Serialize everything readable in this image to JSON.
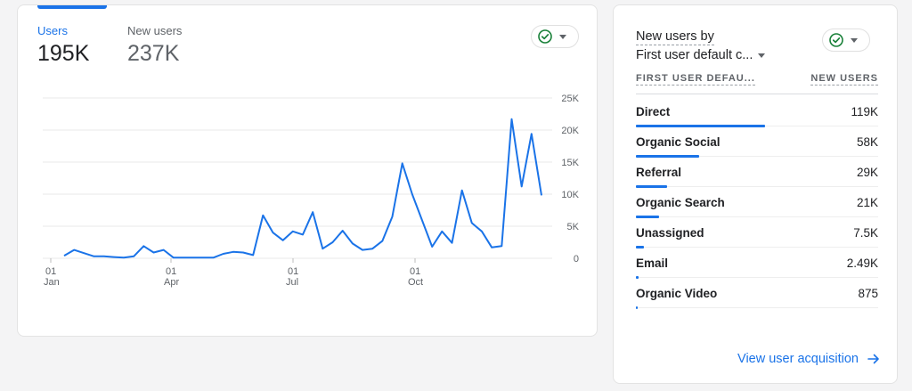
{
  "metrics": {
    "users": {
      "label": "Users",
      "value": "195K"
    },
    "new_users": {
      "label": "New users",
      "value": "237K"
    }
  },
  "colors": {
    "accent": "#1a73e8",
    "check": "#188038",
    "text": "#202124",
    "muted": "#5f6368"
  },
  "icons": {
    "compare": "check-circle-icon",
    "dropdown": "caret-down-icon",
    "link": "arrow-right-icon"
  },
  "chart_data": {
    "type": "line",
    "ylim": [
      0,
      25000
    ],
    "y_ticks": [
      "25K",
      "20K",
      "15K",
      "10K",
      "5K",
      "0"
    ],
    "x_ticks": [
      {
        "day": "01",
        "month": "Jan"
      },
      {
        "day": "01",
        "month": "Apr"
      },
      {
        "day": "01",
        "month": "Jul"
      },
      {
        "day": "01",
        "month": "Oct"
      }
    ],
    "series": [
      {
        "color": "#1a73e8",
        "values": [
          400,
          1300,
          800,
          300,
          300,
          200,
          100,
          300,
          1900,
          900,
          1300,
          100,
          100,
          100,
          100,
          100,
          700,
          1000,
          900,
          500,
          6700,
          4000,
          2800,
          4200,
          3700,
          7200,
          1500,
          2500,
          4300,
          2300,
          1300,
          1500,
          2700,
          6500,
          14800,
          10000,
          5900,
          1800,
          4200,
          2400,
          10600,
          5500,
          4200,
          1700,
          1900,
          21700,
          11200,
          19400,
          9800
        ]
      }
    ]
  },
  "panel": {
    "title_line1": "New users by",
    "title_line2": "First user default c...",
    "col_channel": "FIRST USER DEFAU...",
    "col_new_users": "NEW USERS",
    "rows": [
      {
        "label": "Direct",
        "value": "119K",
        "share": 1.0
      },
      {
        "label": "Organic Social",
        "value": "58K",
        "share": 0.49
      },
      {
        "label": "Referral",
        "value": "29K",
        "share": 0.24
      },
      {
        "label": "Organic Search",
        "value": "21K",
        "share": 0.18
      },
      {
        "label": "Unassigned",
        "value": "7.5K",
        "share": 0.063
      },
      {
        "label": "Email",
        "value": "2.49K",
        "share": 0.021
      },
      {
        "label": "Organic Video",
        "value": "875",
        "share": 0.007
      }
    ],
    "link_label": "View user acquisition"
  }
}
